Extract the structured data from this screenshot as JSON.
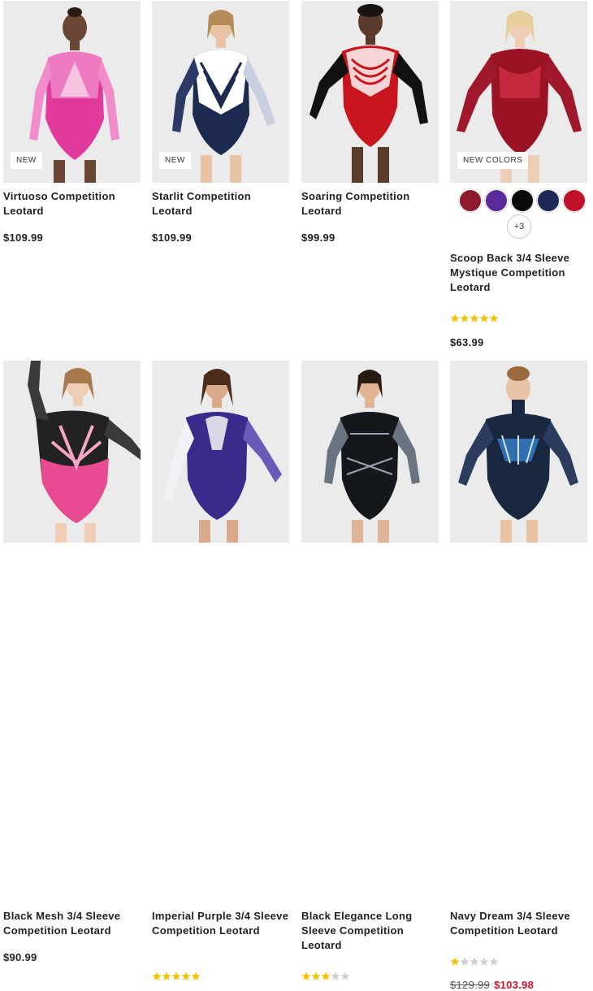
{
  "products": [
    {
      "name": "Virtuoso Competition Leotard",
      "badge": "NEW",
      "price": "$109.99",
      "image_icon": "pink-leotard-image"
    },
    {
      "name": "Starlit Competition Leotard",
      "badge": "NEW",
      "price": "$109.99",
      "image_icon": "navy-leotard-image"
    },
    {
      "name": "Soaring Competition Leotard",
      "price": "$99.99",
      "image_icon": "red-black-leotard-image"
    },
    {
      "name": "Scoop Back 3/4 Sleeve Mystique Competition Leotard",
      "badge": "NEW COLORS",
      "price": "$63.99",
      "rating": 5,
      "more_colors": "+3",
      "swatch_colors": [
        "#8b1a2b",
        "#5b2a9a",
        "#0a0a0a",
        "#1c2a55",
        "#c0102a"
      ],
      "image_icon": "red-velvet-leotard-image"
    },
    {
      "name": "Black Mesh 3/4 Sleeve Competition Leotard",
      "price": "$90.99",
      "image_icon": "black-pink-leotard-image"
    },
    {
      "name": "Imperial Purple 3/4 Sleeve Competition Leotard",
      "rating": 5,
      "image_icon": "purple-leotard-image"
    },
    {
      "name": "Black Elegance Long Sleeve Competition Leotard",
      "rating": 3,
      "image_icon": "black-gray-leotard-image"
    },
    {
      "name": "Navy Dream 3/4 Sleeve Competition Leotard",
      "rating": 1,
      "old_price": "$129.99",
      "sale_price": "$103.98",
      "image_icon": "navy-blue-leotard-image"
    }
  ],
  "colors": {
    "star_filled": "#f2c200",
    "star_empty": "#cfcfcf",
    "sale": "#d0122a"
  }
}
